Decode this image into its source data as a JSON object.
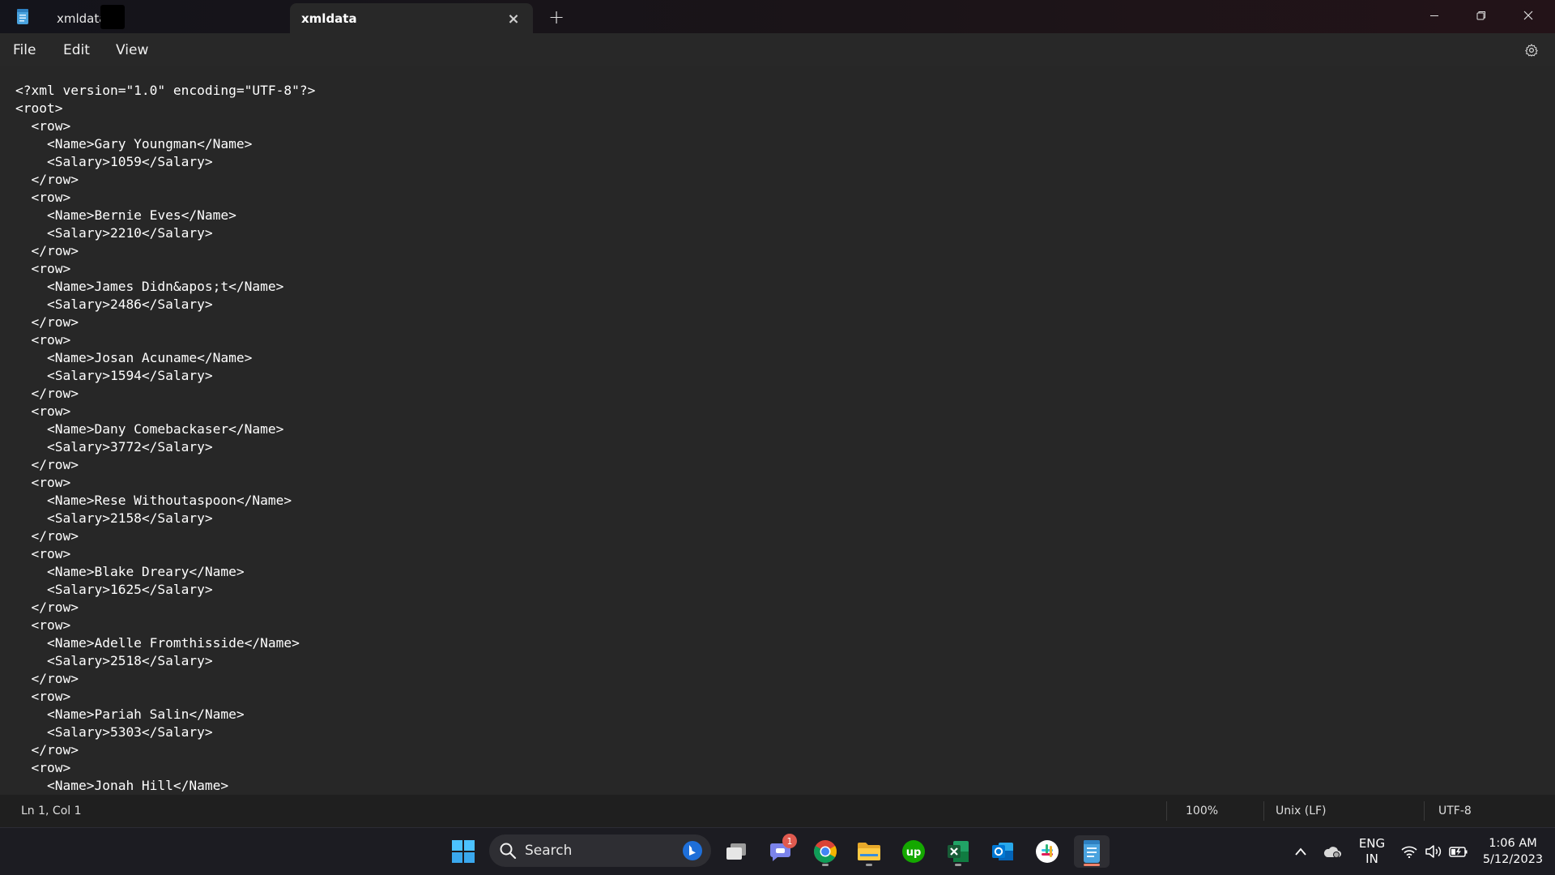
{
  "window": {
    "tabs": [
      {
        "title": "xmldata",
        "active": false
      },
      {
        "title": "xmldata",
        "active": true
      }
    ],
    "close_tab_glyph": "×",
    "new_tab_glyph": "+"
  },
  "menu": [
    "File",
    "Edit",
    "View"
  ],
  "editor": {
    "lines": [
      "<?xml version=\"1.0\" encoding=\"UTF-8\"?>",
      "<root>",
      "  <row>",
      "    <Name>Gary Youngman</Name>",
      "    <Salary>1059</Salary>",
      "  </row>",
      "  <row>",
      "    <Name>Bernie Eves</Name>",
      "    <Salary>2210</Salary>",
      "  </row>",
      "  <row>",
      "    <Name>James Didn&apos;t</Name>",
      "    <Salary>2486</Salary>",
      "  </row>",
      "  <row>",
      "    <Name>Josan Acuname</Name>",
      "    <Salary>1594</Salary>",
      "  </row>",
      "  <row>",
      "    <Name>Dany Comebackaser</Name>",
      "    <Salary>3772</Salary>",
      "  </row>",
      "  <row>",
      "    <Name>Rese Withoutaspoon</Name>",
      "    <Salary>2158</Salary>",
      "  </row>",
      "  <row>",
      "    <Name>Blake Dreary</Name>",
      "    <Salary>1625</Salary>",
      "  </row>",
      "  <row>",
      "    <Name>Adelle Fromthisside</Name>",
      "    <Salary>2518</Salary>",
      "  </row>",
      "  <row>",
      "    <Name>Pariah Salin</Name>",
      "    <Salary>5303</Salary>",
      "  </row>",
      "  <row>",
      "    <Name>Jonah Hill</Name>"
    ]
  },
  "status": {
    "position": "Ln 1, Col 1",
    "zoom": "100%",
    "line_ending": "Unix (LF)",
    "encoding": "UTF-8"
  },
  "taskbar": {
    "search_label": "Search",
    "teams_badge": "1",
    "language": "ENG",
    "region": "IN",
    "time": "1:06 AM",
    "date": "5/12/2023"
  },
  "colors": {
    "editor_bg": "#272727",
    "accent_active": "#f0826a",
    "windows_blue": "#4cc2ff"
  }
}
